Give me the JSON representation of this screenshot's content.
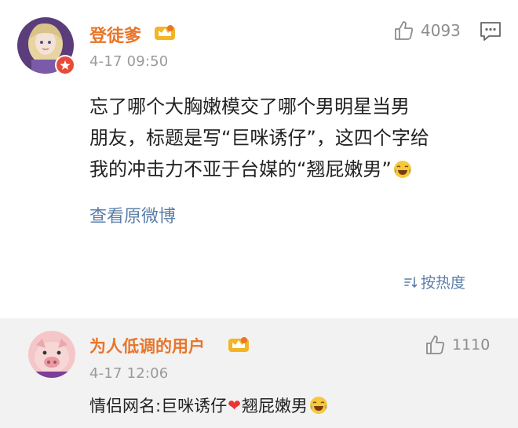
{
  "post": {
    "username": "登徒爹",
    "time": "4-17 09:50",
    "likes": "4093",
    "content_lines": [
      "忘了哪个大胸嫩模交了哪个男明星当男",
      "朋友，标题是写“巨咪诱仔”，这四个字给",
      "我的冲击力不亚于台媒的“翘屁嫩男”"
    ],
    "view_original": "查看原微博",
    "sort_label": "按热度"
  },
  "reply": {
    "username": "为人低调的用户",
    "time": "4-17 12:06",
    "likes": "1110",
    "text_before": "情侣网名:巨咪诱仔",
    "heart": "❤",
    "text_after": "翘屁嫩男"
  },
  "colors": {
    "username": "#e8752a",
    "link": "#5b7ea8",
    "meta": "#9a9a9a",
    "reply_bg": "#f2f2f2",
    "heart": "#e33333"
  },
  "icons": [
    "like-thumb-icon",
    "comment-icon",
    "crown-badge-icon",
    "laugh-cry-emoji-icon",
    "sort-icon",
    "heart-icon"
  ]
}
